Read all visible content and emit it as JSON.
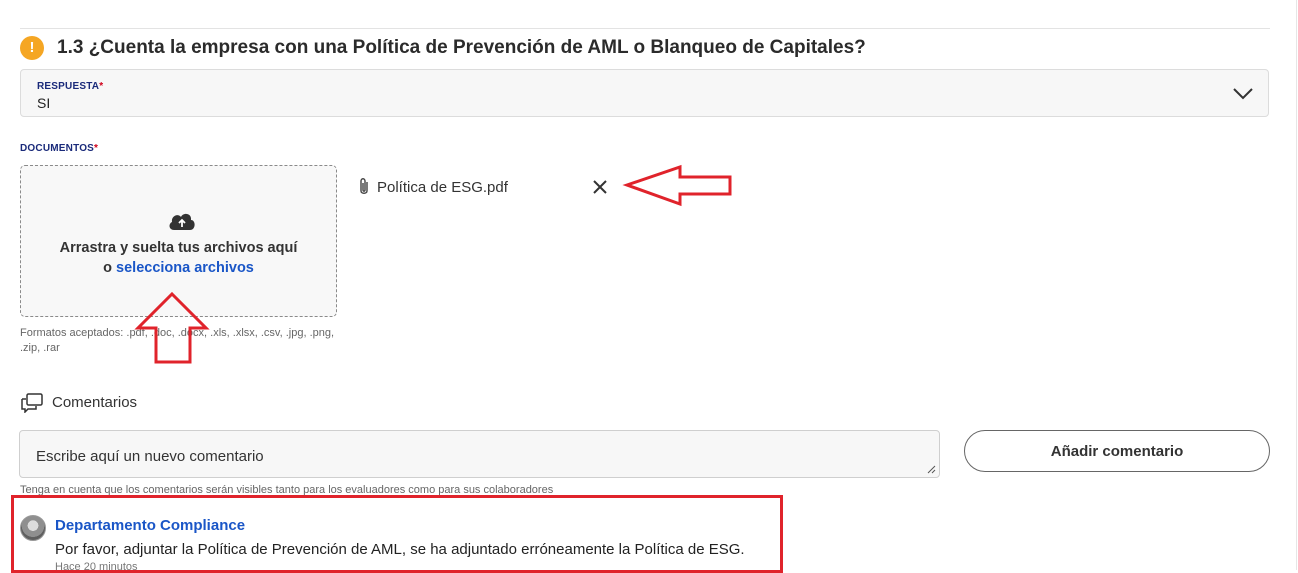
{
  "question": {
    "icon": "warning-icon",
    "icon_glyph": "!",
    "title": "1.3 ¿Cuenta la empresa con una Política de Prevención de AML o Blanqueo de Capitales?"
  },
  "response": {
    "label": "RESPUESTA",
    "required_mark": "*",
    "value": "SI",
    "icon": "chevron-down-icon"
  },
  "documents": {
    "label": "DOCUMENTOS",
    "required_mark": "*",
    "dropzone_text": "Arrastra y suelta tus archivos aquí",
    "dropzone_or": "o ",
    "dropzone_link": "selecciona archivos",
    "formats": "Formatos aceptados: .pdf, .doc, .docx, .xls, .xlsx, .csv, .jpg, .png, .zip, .rar",
    "attached_file": "Política de ESG.pdf"
  },
  "comments": {
    "heading": "Comentarios",
    "placeholder": "Escribe aquí un nuevo comentario",
    "add_button": "Añadir comentario",
    "visibility_note": "Tenga en cuenta que los comentarios serán visibles tanto para los evaluadores como para sus colaboradores",
    "items": [
      {
        "author": "Departamento Compliance",
        "text": "Por favor, adjuntar la Política de Prevención de AML, se ha adjuntado erróneamente la Política de ESG.",
        "time": "Hace 20 minutos"
      }
    ]
  },
  "colors": {
    "accent_link": "#1a56c7",
    "warning": "#f5a623",
    "label_navy": "#1a2a7a",
    "annotation_red": "#e0232b"
  }
}
